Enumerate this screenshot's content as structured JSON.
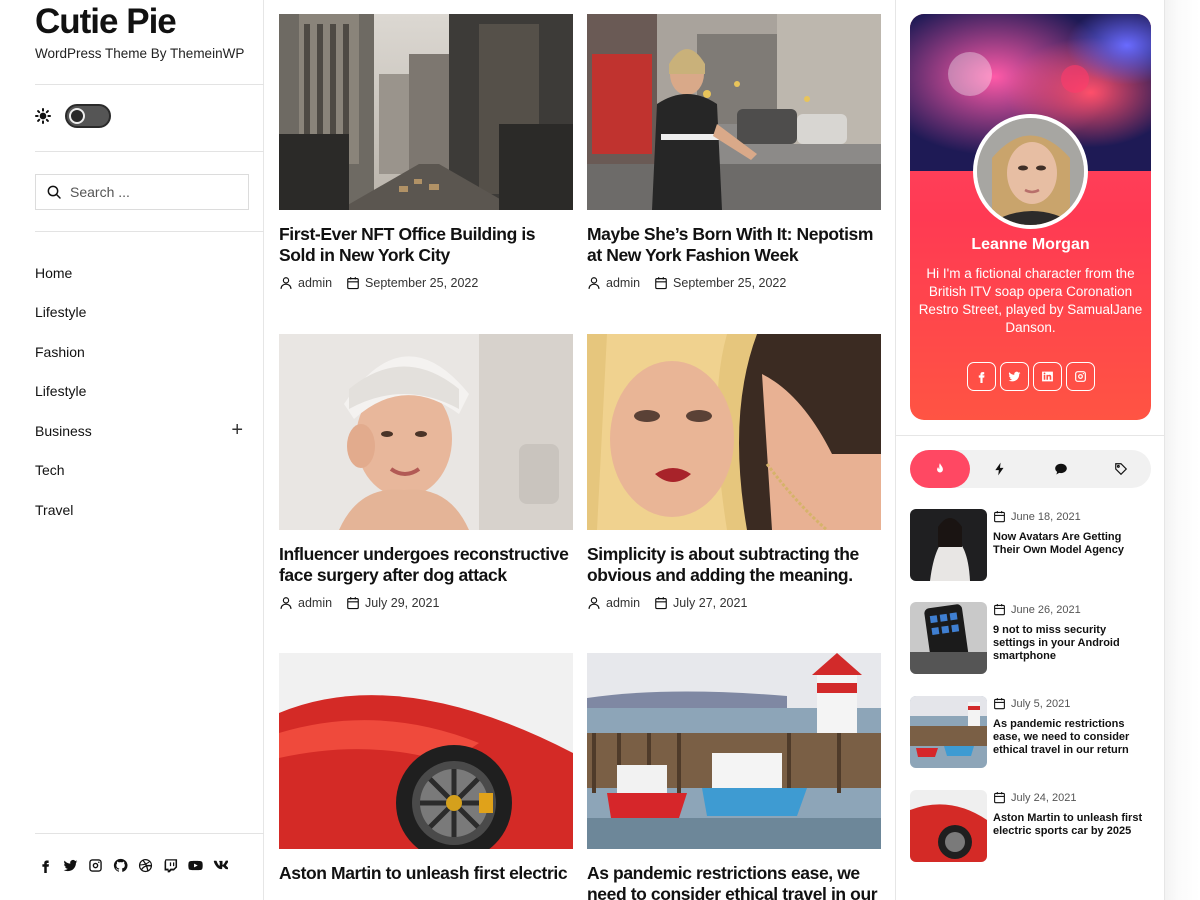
{
  "site": {
    "title": "Cutie Pie",
    "description": "WordPress Theme By ThemeinWP"
  },
  "search": {
    "placeholder": "Search ..."
  },
  "nav": [
    {
      "label": "Home",
      "has_submenu": false
    },
    {
      "label": "Lifestyle",
      "has_submenu": false
    },
    {
      "label": "Fashion",
      "has_submenu": false
    },
    {
      "label": "Lifestyle",
      "has_submenu": false
    },
    {
      "label": "Business",
      "has_submenu": true,
      "toggle": "+"
    },
    {
      "label": "Tech",
      "has_submenu": false
    },
    {
      "label": "Travel",
      "has_submenu": false
    }
  ],
  "footer_social_icons": [
    "facebook-icon",
    "twitter-icon",
    "instagram-icon",
    "github-icon",
    "dribbble-icon",
    "twitch-icon",
    "youtube-icon",
    "vk-icon"
  ],
  "posts": [
    {
      "title": "First-Ever NFT Office Building is Sold in New York City",
      "author": "admin",
      "date": "September 25, 2022"
    },
    {
      "title": "Maybe She’s Born With It: Nepotism at New York Fashion Week",
      "author": "admin",
      "date": "September 25, 2022"
    },
    {
      "title": "Influencer undergoes reconstructive face surgery after dog attack",
      "author": "admin",
      "date": "July 29, 2021"
    },
    {
      "title": "Simplicity is about subtracting the obvious and adding the meaning.",
      "author": "admin",
      "date": "July 27, 2021"
    },
    {
      "title": "Aston Martin to unleash first electric",
      "author": "",
      "date": ""
    },
    {
      "title": "As pandemic restrictions ease, we need to consider ethical travel in our",
      "author": "",
      "date": ""
    }
  ],
  "profile": {
    "name": "Leanne Morgan",
    "bio": "Hi I'm a fictional character from the British ITV soap opera Coronation Restro Street, played by SamualJane Danson.",
    "social_icons": [
      "facebook-icon",
      "twitter-icon",
      "linkedin-icon",
      "instagram-icon"
    ]
  },
  "tabs": [
    {
      "icon": "fire-icon",
      "active": true
    },
    {
      "icon": "bolt-icon",
      "active": false
    },
    {
      "icon": "comment-icon",
      "active": false
    },
    {
      "icon": "tag-icon",
      "active": false
    }
  ],
  "recent": [
    {
      "date": "June 18, 2021",
      "title": "Now Avatars Are Getting Their Own Model Agency"
    },
    {
      "date": "June 26, 2021",
      "title": "9 not to miss security settings in your Android smartphone"
    },
    {
      "date": "July 5, 2021",
      "title": "As pandemic restrictions ease, we need to consider ethical travel in our return"
    },
    {
      "date": "July 24, 2021",
      "title": "Aston Martin to unleash first electric sports car by 2025"
    }
  ],
  "colors": {
    "accent": "#ff4863",
    "text": "#111111"
  }
}
